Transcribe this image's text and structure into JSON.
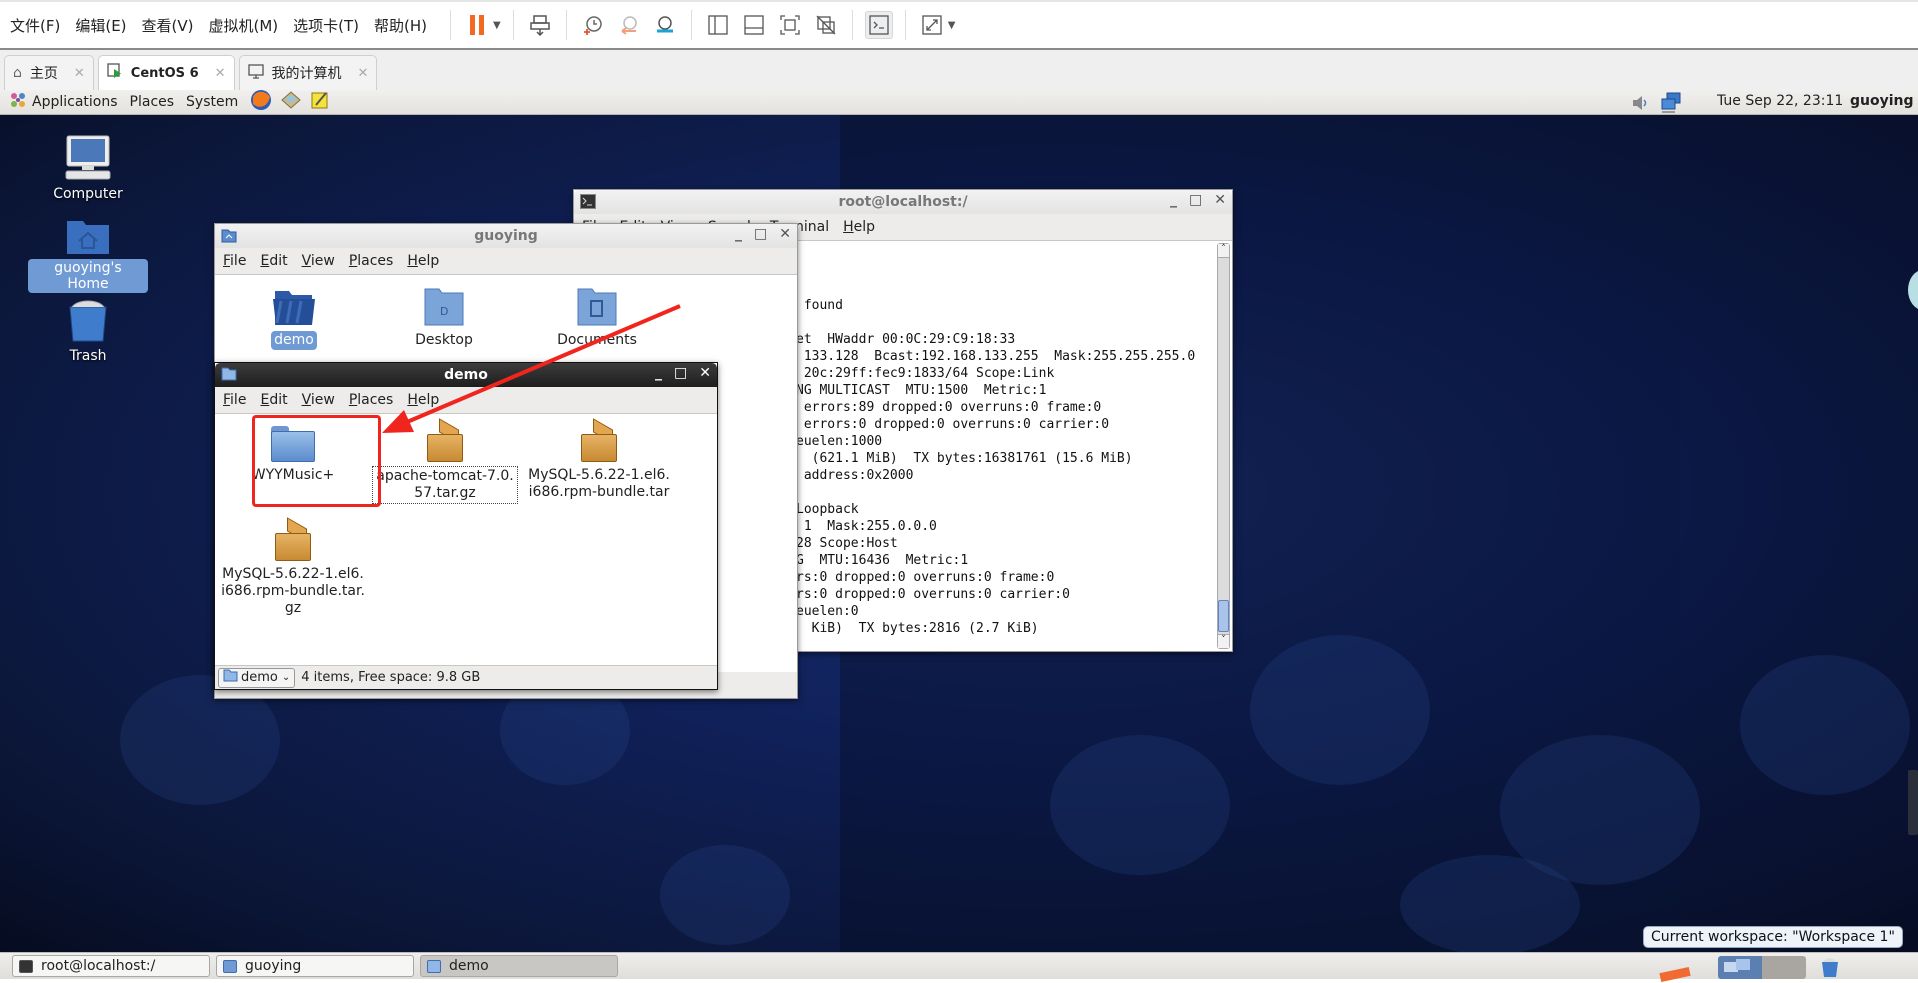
{
  "vm_menubar": {
    "menus": [
      "文件(F)",
      "编辑(E)",
      "查看(V)",
      "虚拟机(M)",
      "选项卡(T)",
      "帮助(H)"
    ],
    "toolbar_icons": [
      "pause-icon",
      "send-ctrl-alt-del-icon",
      "snapshot-take-icon",
      "snapshot-revert-icon",
      "snapshot-manager-icon",
      "sidebar-layout-icon",
      "thumbnail-layout-icon",
      "fit-guest-icon",
      "unity-off-icon",
      "console-view-icon",
      "fullscreen-icon"
    ]
  },
  "vm_tabs": [
    {
      "label": "主页",
      "icon": "home-icon",
      "active": false
    },
    {
      "label": "CentOS 6",
      "icon": "vm-running-icon",
      "active": true
    },
    {
      "label": "我的计算机",
      "icon": "monitor-icon",
      "active": false
    }
  ],
  "top_panel": {
    "menus": [
      "Applications",
      "Places",
      "System"
    ],
    "launchers": [
      "firefox-icon",
      "mail-icon",
      "notes-icon"
    ],
    "clock": "Tue Sep 22, 23:11",
    "user": "guoying"
  },
  "desktop_icons": [
    {
      "label": "Computer",
      "selected": false
    },
    {
      "label": "guoying's Home",
      "selected": true
    },
    {
      "label": "Trash",
      "selected": false
    }
  ],
  "terminal": {
    "title": "root@localhost:/",
    "menus": [
      "File",
      "Edit",
      "View",
      "Search",
      "Terminal",
      "Help"
    ],
    "lines": [
      "",
      "",
      " found",
      "",
      "et  HWaddr 00:0C:29:C9:18:33",
      " 133.128  Bcast:192.168.133.255  Mask:255.255.255.0",
      " 20c:29ff:fec9:1833/64 Scope:Link",
      "NG MULTICAST  MTU:1500  Metric:1",
      " errors:89 dropped:0 overruns:0 frame:0",
      " errors:0 dropped:0 overruns:0 carrier:0",
      "euelen:1000",
      "  (621.1 MiB)  TX bytes:16381761 (15.6 MiB)",
      " address:0x2000",
      "",
      "Loopback",
      " 1  Mask:255.0.0.0",
      "28 Scope:Host",
      "G  MTU:16436  Metric:1",
      "rs:0 dropped:0 overruns:0 frame:0",
      "rs:0 dropped:0 overruns:0 carrier:0",
      "euelen:0",
      "  KiB)  TX bytes:2816 (2.7 KiB)"
    ]
  },
  "guoying_window": {
    "title": "guoying",
    "menus": [
      "File",
      "Edit",
      "View",
      "Places",
      "Help"
    ],
    "items": [
      {
        "label": "demo",
        "type": "folder-open",
        "selected": true
      },
      {
        "label": "Desktop",
        "type": "folder-desktop",
        "selected": false
      },
      {
        "label": "Documents",
        "type": "folder-documents",
        "selected": false
      }
    ]
  },
  "demo_window": {
    "title": "demo",
    "menus": [
      "File",
      "Edit",
      "View",
      "Places",
      "Help"
    ],
    "items": [
      {
        "label": "WYYMusic+",
        "type": "folder",
        "highlighted": true
      },
      {
        "label": "apache-tomcat-7.0.57.tar.gz",
        "line1": "apache-tomcat-7.0.",
        "line2": "57.tar.gz",
        "type": "archive",
        "focused": true
      },
      {
        "label": "MySQL-5.6.22-1.el6.i686.rpm-bundle.tar",
        "line1": "MySQL-5.6.22-1.el6.",
        "line2": "i686.rpm-bundle.tar",
        "type": "archive"
      },
      {
        "label": "MySQL-5.6.22-1.el6.i686.rpm-bundle.tar.gz",
        "line1": "MySQL-5.6.22-1.el6.",
        "line2": "i686.rpm-bundle.tar.",
        "line3": "gz",
        "type": "archive"
      }
    ],
    "location": "demo",
    "status": "4 items, Free space: 9.8 GB"
  },
  "annotation": {
    "color": "#f0261e",
    "target": "WYYMusic+"
  },
  "bottom_panel": {
    "tasks": [
      {
        "label": "root@localhost:/",
        "icon": "terminal-icon",
        "active": false
      },
      {
        "label": "guoying",
        "icon": "home-folder-icon",
        "active": false
      },
      {
        "label": "demo",
        "icon": "folder-icon",
        "active": true
      }
    ],
    "tooltip": "Current workspace: \"Workspace 1\""
  },
  "colors": {
    "selection": "#6f9ad4",
    "pause": "#f26a21",
    "desktop": "#10215a"
  }
}
